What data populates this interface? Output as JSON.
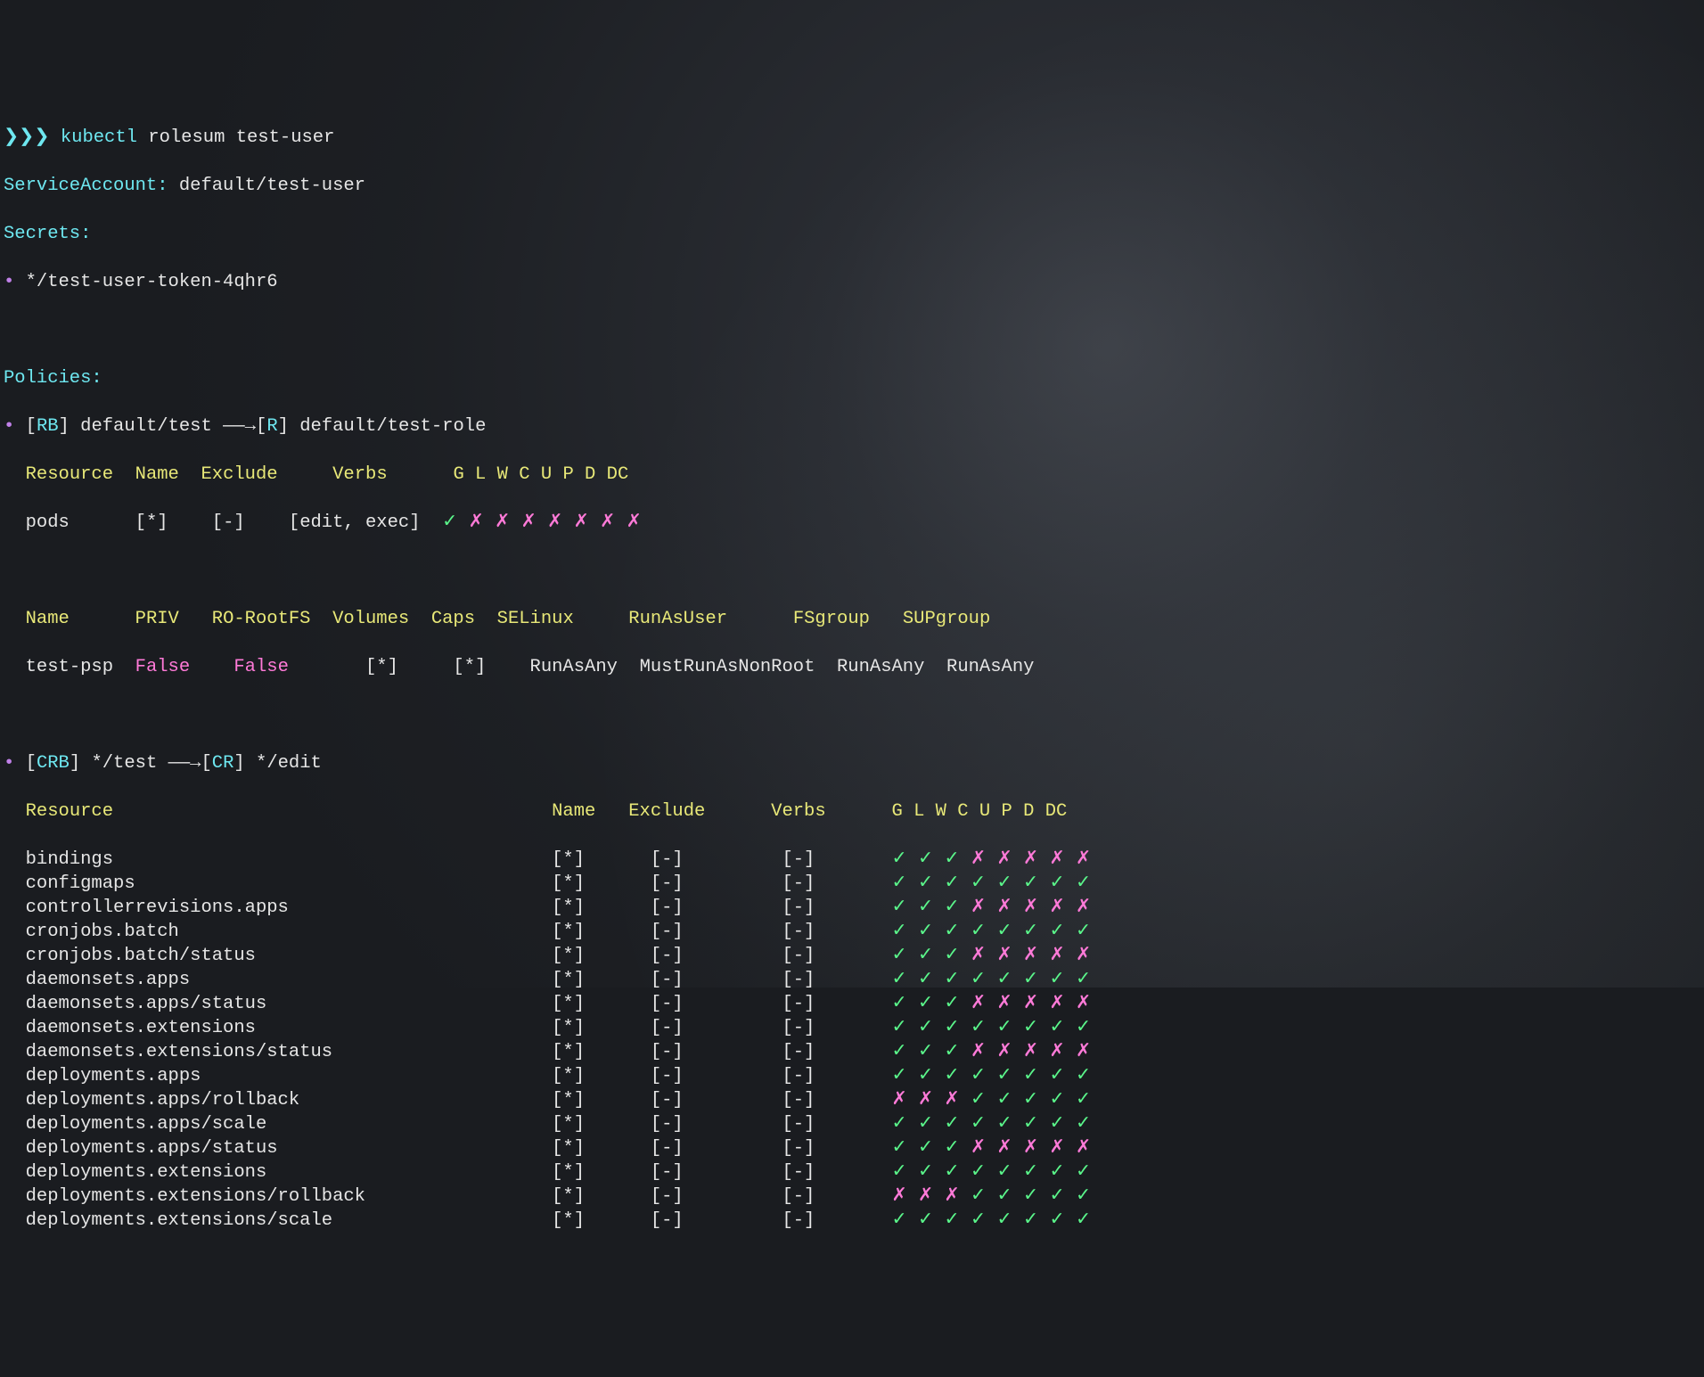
{
  "prompt": {
    "arrows": "❯❯❯",
    "cmd_part1": "kubectl",
    "cmd_part2": "rolesum test-user"
  },
  "service_account": {
    "label": "ServiceAccount:",
    "value": "default/test-user"
  },
  "secrets": {
    "label": "Secrets:",
    "items": [
      "*/test-user-token-4qhr6"
    ]
  },
  "policies": {
    "label": "Policies:"
  },
  "binding1": {
    "kind1": "RB",
    "name1": "default/test",
    "arrow": "——→",
    "kind2": "R",
    "name2": "default/test-role",
    "header": {
      "resource": "Resource",
      "name": "Name",
      "exclude": "Exclude",
      "verbs": "Verbs",
      "flags": "G L W C U P D DC"
    },
    "rows": [
      {
        "resource": "pods",
        "name": "[*]",
        "exclude": "[-]",
        "verbs": "[edit, exec]",
        "flags": "✓ ✗ ✗ ✗ ✗ ✗ ✗ ✗"
      }
    ],
    "psp_header": {
      "name": "Name",
      "priv": "PRIV",
      "rorootfs": "RO-RootFS",
      "volumes": "Volumes",
      "caps": "Caps",
      "selinux": "SELinux",
      "runasuser": "RunAsUser",
      "fsgroup": "FSgroup",
      "supgroup": "SUPgroup"
    },
    "psp_rows": [
      {
        "name": "test-psp",
        "priv": "False",
        "rorootfs": "False",
        "volumes": "[*]",
        "caps": "[*]",
        "selinux": "RunAsAny",
        "runasuser": "MustRunAsNonRoot",
        "fsgroup": "RunAsAny",
        "supgroup": "RunAsAny"
      }
    ]
  },
  "binding2": {
    "kind1": "CRB",
    "name1": "*/test",
    "arrow": "——→",
    "kind2": "CR",
    "name2": "*/edit",
    "header": {
      "resource": "Resource",
      "name": "Name",
      "exclude": "Exclude",
      "verbs": "Verbs",
      "flags": "G L W C U P D DC"
    },
    "rows": [
      {
        "resource": "bindings",
        "name": "[*]",
        "exclude": "[-]",
        "verbs": "[-]",
        "flags": "✓ ✓ ✓ ✗ ✗ ✗ ✗ ✗"
      },
      {
        "resource": "configmaps",
        "name": "[*]",
        "exclude": "[-]",
        "verbs": "[-]",
        "flags": "✓ ✓ ✓ ✓ ✓ ✓ ✓ ✓"
      },
      {
        "resource": "controllerrevisions.apps",
        "name": "[*]",
        "exclude": "[-]",
        "verbs": "[-]",
        "flags": "✓ ✓ ✓ ✗ ✗ ✗ ✗ ✗"
      },
      {
        "resource": "cronjobs.batch",
        "name": "[*]",
        "exclude": "[-]",
        "verbs": "[-]",
        "flags": "✓ ✓ ✓ ✓ ✓ ✓ ✓ ✓"
      },
      {
        "resource": "cronjobs.batch/status",
        "name": "[*]",
        "exclude": "[-]",
        "verbs": "[-]",
        "flags": "✓ ✓ ✓ ✗ ✗ ✗ ✗ ✗"
      },
      {
        "resource": "daemonsets.apps",
        "name": "[*]",
        "exclude": "[-]",
        "verbs": "[-]",
        "flags": "✓ ✓ ✓ ✓ ✓ ✓ ✓ ✓"
      },
      {
        "resource": "daemonsets.apps/status",
        "name": "[*]",
        "exclude": "[-]",
        "verbs": "[-]",
        "flags": "✓ ✓ ✓ ✗ ✗ ✗ ✗ ✗"
      },
      {
        "resource": "daemonsets.extensions",
        "name": "[*]",
        "exclude": "[-]",
        "verbs": "[-]",
        "flags": "✓ ✓ ✓ ✓ ✓ ✓ ✓ ✓"
      },
      {
        "resource": "daemonsets.extensions/status",
        "name": "[*]",
        "exclude": "[-]",
        "verbs": "[-]",
        "flags": "✓ ✓ ✓ ✗ ✗ ✗ ✗ ✗"
      },
      {
        "resource": "deployments.apps",
        "name": "[*]",
        "exclude": "[-]",
        "verbs": "[-]",
        "flags": "✓ ✓ ✓ ✓ ✓ ✓ ✓ ✓"
      },
      {
        "resource": "deployments.apps/rollback",
        "name": "[*]",
        "exclude": "[-]",
        "verbs": "[-]",
        "flags": "✗ ✗ ✗ ✓ ✓ ✓ ✓ ✓"
      },
      {
        "resource": "deployments.apps/scale",
        "name": "[*]",
        "exclude": "[-]",
        "verbs": "[-]",
        "flags": "✓ ✓ ✓ ✓ ✓ ✓ ✓ ✓"
      },
      {
        "resource": "deployments.apps/status",
        "name": "[*]",
        "exclude": "[-]",
        "verbs": "[-]",
        "flags": "✓ ✓ ✓ ✗ ✗ ✗ ✗ ✗"
      },
      {
        "resource": "deployments.extensions",
        "name": "[*]",
        "exclude": "[-]",
        "verbs": "[-]",
        "flags": "✓ ✓ ✓ ✓ ✓ ✓ ✓ ✓"
      },
      {
        "resource": "deployments.extensions/rollback",
        "name": "[*]",
        "exclude": "[-]",
        "verbs": "[-]",
        "flags": "✗ ✗ ✗ ✓ ✓ ✓ ✓ ✓"
      },
      {
        "resource": "deployments.extensions/scale",
        "name": "[*]",
        "exclude": "[-]",
        "verbs": "[-]",
        "flags": "✓ ✓ ✓ ✓ ✓ ✓ ✓ ✓"
      }
    ]
  }
}
